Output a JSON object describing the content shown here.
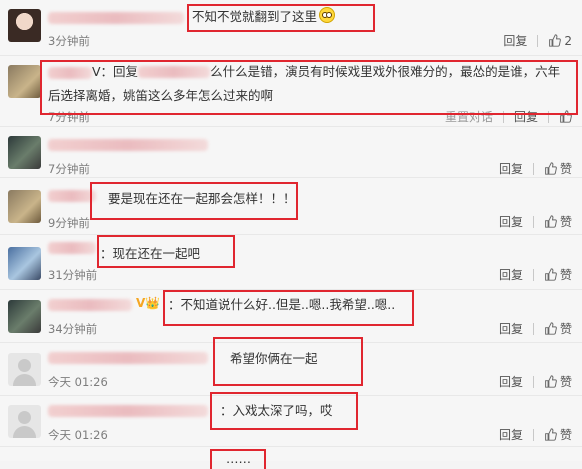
{
  "actions": {
    "reply": "回复",
    "like": "赞",
    "report": "重置对话"
  },
  "comments": [
    {
      "text": "不知不觉就翻到了这里",
      "time": "3分钟前",
      "like_count": "2"
    },
    {
      "prefix": "V：回复",
      "text": "么什么是错，演员有时候戏里戏外很难分的，最怂的是谁，六年",
      "text2": "后选择离婚，姚笛这么多年怎么过来的啊",
      "time": "7分钟前"
    },
    {
      "time": "7分钟前"
    },
    {
      "text": "要是现在还在一起那会怎样！！！",
      "time": "9分钟前"
    },
    {
      "text": "：现在还在一起吧",
      "time": "31分钟前"
    },
    {
      "text": "：不知道说什么好..但是..嗯..我希望..嗯..",
      "time": "34分钟前"
    },
    {
      "text": "希望你俩在一起",
      "time": "今天 01:26"
    },
    {
      "text": "：入戏太深了吗，哎",
      "time": "今天 01:26"
    },
    {
      "text": "……"
    }
  ]
}
